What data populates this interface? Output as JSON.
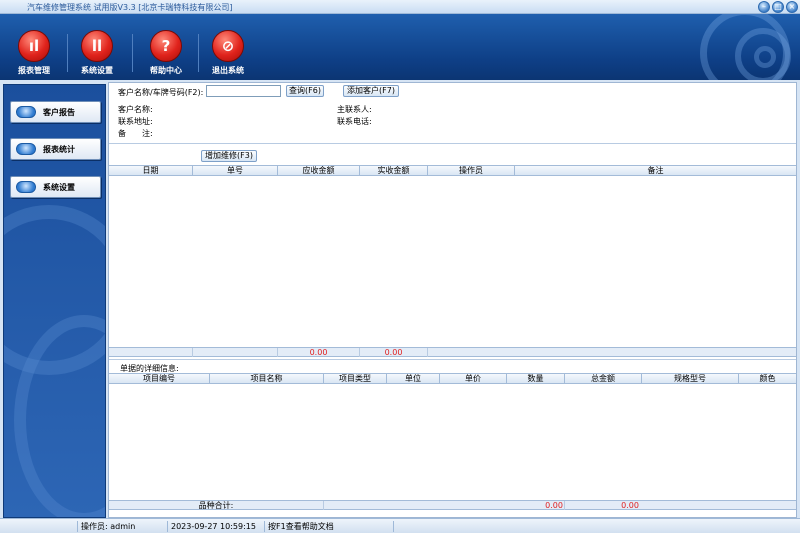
{
  "window": {
    "title": "汽车维修管理系统 试用版V3.3 [北京卡瑞特科技有限公司]"
  },
  "toolbar": {
    "items": [
      {
        "label": "报表管理",
        "icon": "bar-chart-icon",
        "glyph": "ıl"
      },
      {
        "label": "系统设置",
        "icon": "tools-icon",
        "glyph": "ll"
      },
      {
        "label": "帮助中心",
        "icon": "help-icon",
        "glyph": "?"
      },
      {
        "label": "退出系统",
        "icon": "exit-icon",
        "glyph": "⊘"
      }
    ]
  },
  "sidebar": {
    "items": [
      {
        "label": "客户报告"
      },
      {
        "label": "报表统计"
      },
      {
        "label": "系统设置"
      }
    ]
  },
  "search": {
    "label": "客户名称/车牌号码(F2):",
    "value": "",
    "query_button": "查询(F6)",
    "add_customer_button": "添加客户(F7)"
  },
  "customer_info": {
    "name_label": "客户名称:",
    "address_label": "联系地址:",
    "remark_label": "备　　注:",
    "contact_label": "主联系人:",
    "phone_label": "联系电话:"
  },
  "repair_grid": {
    "add_button": "增加维修(F3)",
    "columns": [
      "日期",
      "单号",
      "应收金额",
      "实收金额",
      "操作员",
      "备注"
    ],
    "totals": {
      "receivable": "0.00",
      "received": "0.00"
    }
  },
  "detail_grid": {
    "section_label": "单据的详细信息:",
    "columns": [
      "项目编号",
      "项目名称",
      "项目类型",
      "单位",
      "单价",
      "数量",
      "总金额",
      "规格型号",
      "颜色"
    ],
    "total_label": "品种合计:",
    "totals": {
      "total_amount": "0.00",
      "spec_amount": "0.00"
    }
  },
  "statusbar": {
    "operator": "操作员: admin",
    "datetime": "2023-09-27 10:59:15",
    "help_hint": "按F1查看帮助文档"
  },
  "colors": {
    "toolbar_bg": "#1a5aa8",
    "sidebar_bg": "#2058a6",
    "accent_red": "#e02020"
  }
}
